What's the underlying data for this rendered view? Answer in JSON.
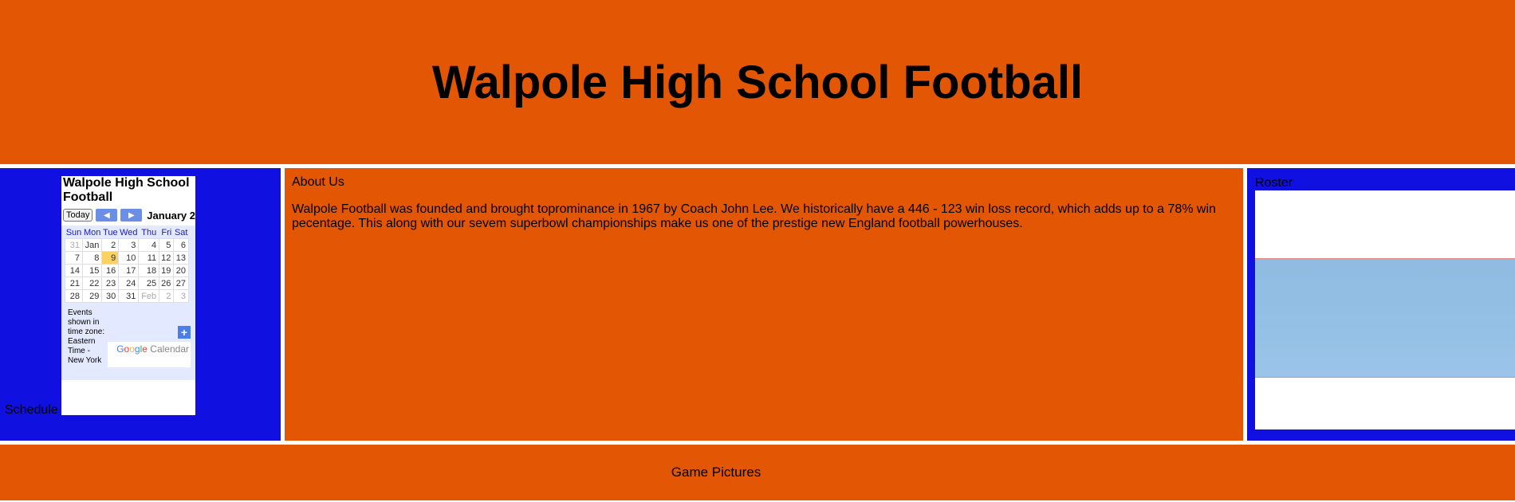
{
  "header": {
    "title": "Walpole High School Football"
  },
  "schedule": {
    "label": "Schedule",
    "calendar": {
      "title": "Walpole High School Football",
      "today_label": "Today",
      "prev_icon": "chevron-left-icon",
      "next_icon": "chevron-right-icon",
      "month_label": "January 2",
      "weekdays": [
        "Sun",
        "Mon",
        "Tue",
        "Wed",
        "Thu",
        "Fri",
        "Sat"
      ],
      "weeks": [
        [
          "31",
          "Jan",
          "2",
          "3",
          "4",
          "5",
          "6"
        ],
        [
          "7",
          "8",
          "9",
          "10",
          "11",
          "12",
          "13"
        ],
        [
          "14",
          "15",
          "16",
          "17",
          "18",
          "19",
          "20"
        ],
        [
          "21",
          "22",
          "23",
          "24",
          "25",
          "26",
          "27"
        ],
        [
          "28",
          "29",
          "30",
          "31",
          "Feb",
          "2",
          "3"
        ]
      ],
      "today_cell": "9",
      "timezone_note": "Events shown in time zone: Eastern Time - New York",
      "add_icon": "plus-icon",
      "brand_google": "Google",
      "brand_calendar": "Calendar",
      "colors": {
        "accent": "#6a8fe4",
        "today": "#fad163",
        "grid_bg": "#e3e9ff"
      }
    }
  },
  "about": {
    "title": "About Us",
    "text": "Walpole Football was founded and brought toprominance in 1967 by Coach John Lee. We historically have a 446 - 123 win loss record, which adds up to a 78% win pecentage. This along with our sevem superbowl championships make us one of the prestige new England football powerhouses."
  },
  "roster": {
    "title": "Roster"
  },
  "footer": {
    "label": "Game Pictures"
  },
  "colors": {
    "orange": "#e35604",
    "blue": "#1010e0"
  }
}
